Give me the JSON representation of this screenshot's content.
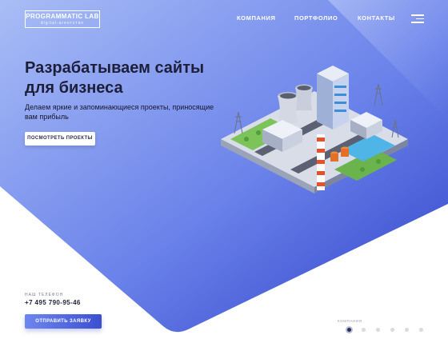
{
  "header": {
    "logo_title": "PROGRAMMATIC LAB",
    "logo_subtitle": "digital-агентство",
    "nav": [
      {
        "label": "КОМПАНИЯ"
      },
      {
        "label": "ПОРТФОЛИО"
      },
      {
        "label": "КОНТАКТЫ"
      }
    ],
    "menu_icon": "hamburger-icon"
  },
  "hero": {
    "title": "Разрабатываем сайты для бизнеса",
    "subtitle": "Делаем яркие и запоминающиеся проекты, приносящие вам прибыль",
    "cta_label": "ПОСМОТРЕТЬ ПРОЕКТЫ",
    "illustration": "isometric-industrial-city-illustration"
  },
  "contact": {
    "phone_label": "НАШ ТЕЛЕФОН",
    "phone": "+7 495 790-95-46",
    "request_label": "ОТПРАВИТЬ ЗАЯВКУ"
  },
  "pager": {
    "label": "КОМПАНИЯ",
    "count": 6,
    "active": 1
  },
  "colors": {
    "gradient_light": "#a9bdf6",
    "gradient_dark": "#3447cf",
    "text_dark": "#1d1f3a",
    "background": "#ffffff"
  }
}
